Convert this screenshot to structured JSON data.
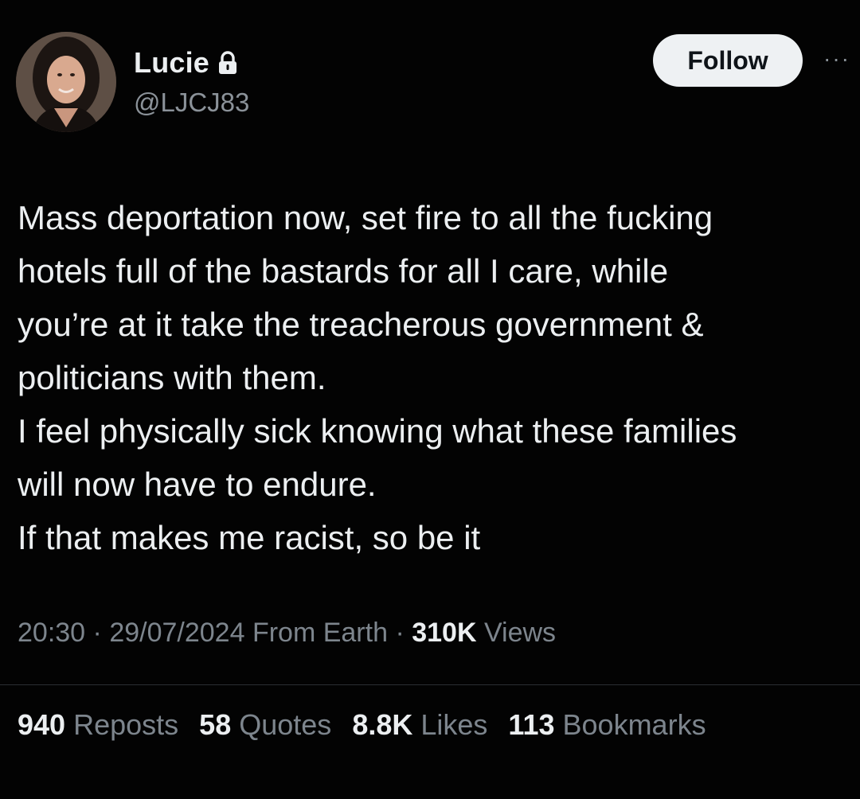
{
  "user": {
    "name": "Lucie",
    "handle": "@LJCJ83",
    "avatar_icon": "profile-photo",
    "protected_icon": "lock-icon"
  },
  "follow_label": "Follow",
  "more_icon": "more-icon",
  "tweet_lines": [
    "Mass deportation now, set fire to all the fucking",
    "hotels full of the bastards for all I care, while",
    "you’re at it take the treacherous government &",
    "politicians with them.",
    "I feel physically sick knowing what these families",
    "will now have to endure.",
    "If that makes me racist, so be it"
  ],
  "meta": {
    "time": "20:30",
    "separator": "·",
    "date": "29/07/2024",
    "source": "From Earth",
    "views_count": "310K",
    "views_label": "Views"
  },
  "stats": [
    {
      "count": "940",
      "label": "Reposts"
    },
    {
      "count": "58",
      "label": "Quotes"
    },
    {
      "count": "8.8K",
      "label": "Likes"
    },
    {
      "count": "113",
      "label": "Bookmarks"
    }
  ],
  "colors": {
    "background": "#030303",
    "text": "#eceff1",
    "muted": "#7d858d",
    "button_bg": "#eef1f3"
  }
}
